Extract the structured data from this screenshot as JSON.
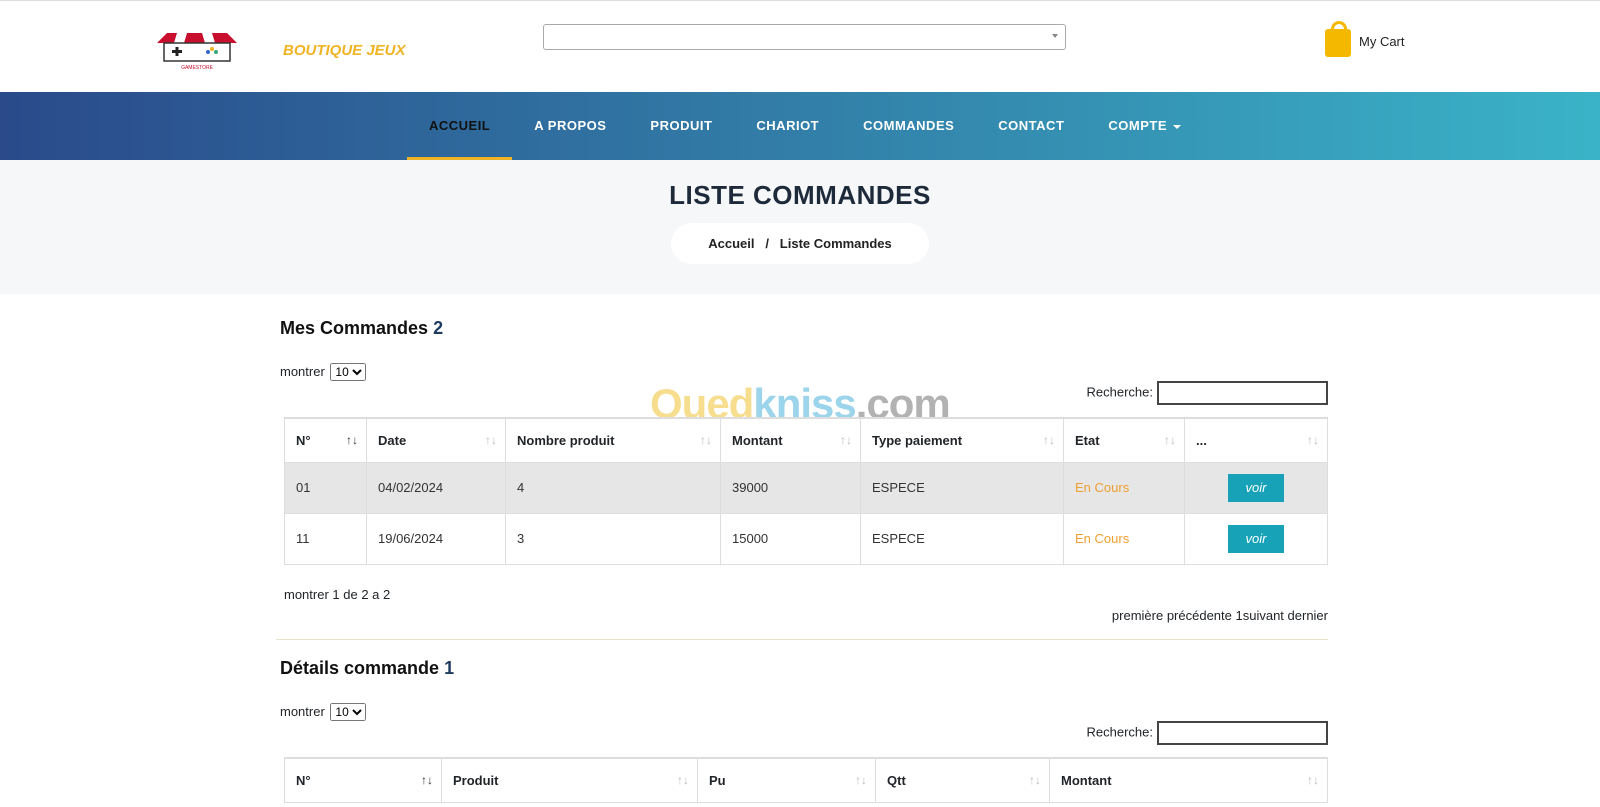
{
  "header": {
    "brand": "BOUTIQUE JEUX",
    "logo_text": "GAMESTORE",
    "cart_label": "My Cart",
    "search_value": ""
  },
  "nav": [
    "ACCUEIL",
    "A PROPOS",
    "PRODUIT",
    "CHARIOT",
    "COMMANDES",
    "CONTACT",
    "COMPTE"
  ],
  "hero": {
    "title": "LISTE COMMANDES",
    "crumb_home": "Accueil",
    "crumb_sep": "/",
    "crumb_current": "Liste Commandes"
  },
  "watermark": {
    "a": "Oued",
    "b": "kniss",
    ".com": ".com"
  },
  "orders": {
    "title": "Mes Commandes",
    "count": "2",
    "show_label": "montrer",
    "show_value": "10",
    "search_label": "Recherche:",
    "columns": [
      "N°",
      "Date",
      "Nombre produit",
      "Montant",
      "Type paiement",
      "Etat",
      "..."
    ],
    "rows": [
      [
        "01",
        "04/02/2024",
        "4",
        "39000",
        "ESPECE",
        "En Cours",
        "voir"
      ],
      [
        "11",
        "19/06/2024",
        "3",
        "15000",
        "ESPECE",
        "En Cours",
        "voir"
      ]
    ],
    "info": "montrer 1 de 2 a 2",
    "pagination": "première précédente 1suivant dernier"
  },
  "details": {
    "title": "Détails commande",
    "count": "1",
    "show_label": "montrer",
    "show_value": "10",
    "search_label": "Recherche:",
    "columns": [
      "N°",
      "Produit",
      "Pu",
      "Qtt",
      "Montant"
    ]
  },
  "colors": {
    "accent": "#f0b323",
    "button": "#17a2b8",
    "status": "#f0a030"
  }
}
